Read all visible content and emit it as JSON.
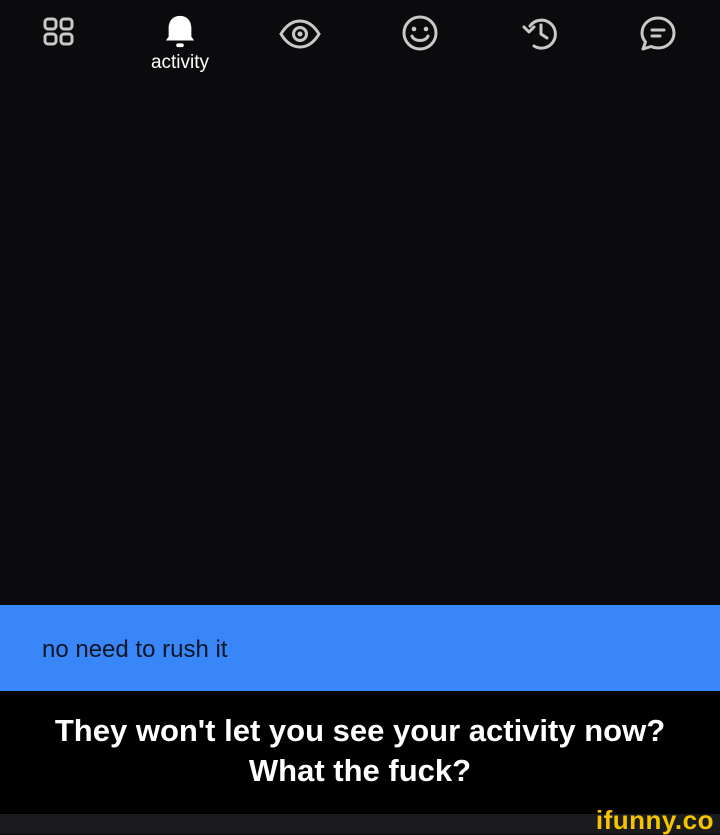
{
  "nav": {
    "items": [
      {
        "icon": "grid-icon",
        "label": ""
      },
      {
        "icon": "bell-icon",
        "label": "activity"
      },
      {
        "icon": "eye-icon",
        "label": ""
      },
      {
        "icon": "smiley-icon",
        "label": ""
      },
      {
        "icon": "history-icon",
        "label": ""
      },
      {
        "icon": "chat-icon",
        "label": ""
      }
    ]
  },
  "toast": {
    "text": "no need to rush it",
    "color": "#3886f7"
  },
  "caption": {
    "line1": "They won't let you see your activity now?",
    "line2": "What the fuck?"
  },
  "watermark": {
    "text": "ifunny.co",
    "color": "#f5c400"
  }
}
